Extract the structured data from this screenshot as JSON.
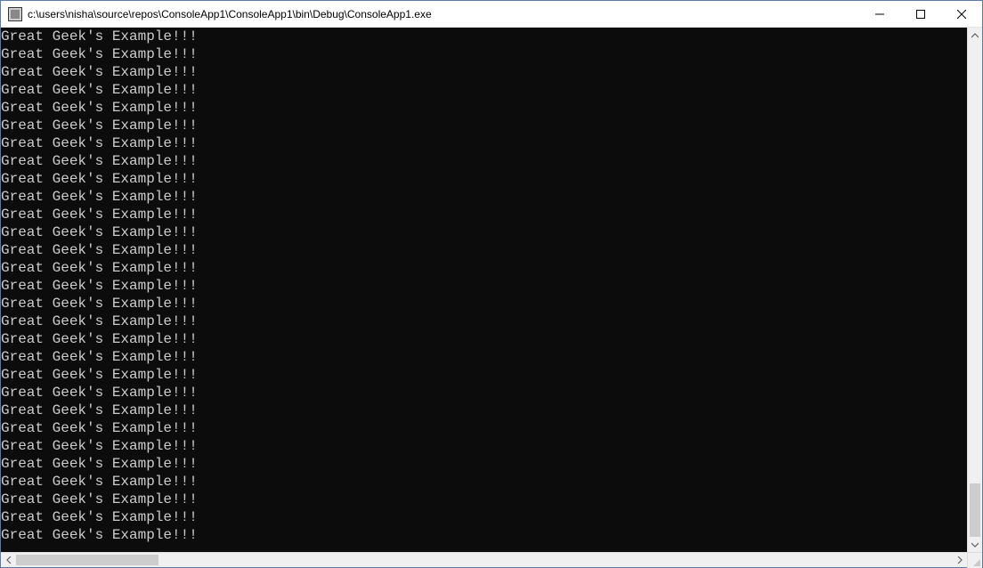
{
  "window": {
    "title": "c:\\users\\nisha\\source\\repos\\ConsoleApp1\\ConsoleApp1\\bin\\Debug\\ConsoleApp1.exe"
  },
  "console": {
    "line_text": "Great Geek's Example!!!",
    "line_count": 29
  }
}
